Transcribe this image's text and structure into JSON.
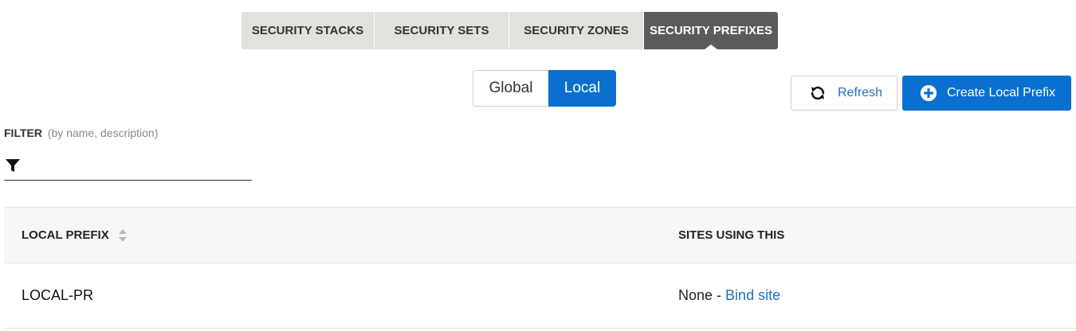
{
  "tabs": [
    {
      "label": "SECURITY STACKS",
      "active": false
    },
    {
      "label": "SECURITY SETS",
      "active": false
    },
    {
      "label": "SECURITY ZONES",
      "active": false
    },
    {
      "label": "SECURITY PREFIXES",
      "active": true
    }
  ],
  "scope_toggle": {
    "global_label": "Global",
    "local_label": "Local",
    "selected": "Local"
  },
  "actions": {
    "refresh_label": "Refresh",
    "create_label": "Create Local Prefix"
  },
  "filter": {
    "title": "FILTER",
    "hint": "(by name, description)",
    "value": ""
  },
  "table": {
    "columns": [
      "LOCAL PREFIX",
      "SITES USING THIS"
    ],
    "rows": [
      {
        "name": "LOCAL-PR",
        "sites_text": "None -",
        "bind_link": "Bind site"
      }
    ]
  },
  "colors": {
    "primary": "#0a70cf",
    "link": "#1f6fc2",
    "tab_bg": "#e3e1de",
    "tab_active_bg": "#5c5b59"
  },
  "icons": [
    "refresh-icon",
    "plus-circle-icon",
    "filter-icon",
    "sort-icon"
  ]
}
